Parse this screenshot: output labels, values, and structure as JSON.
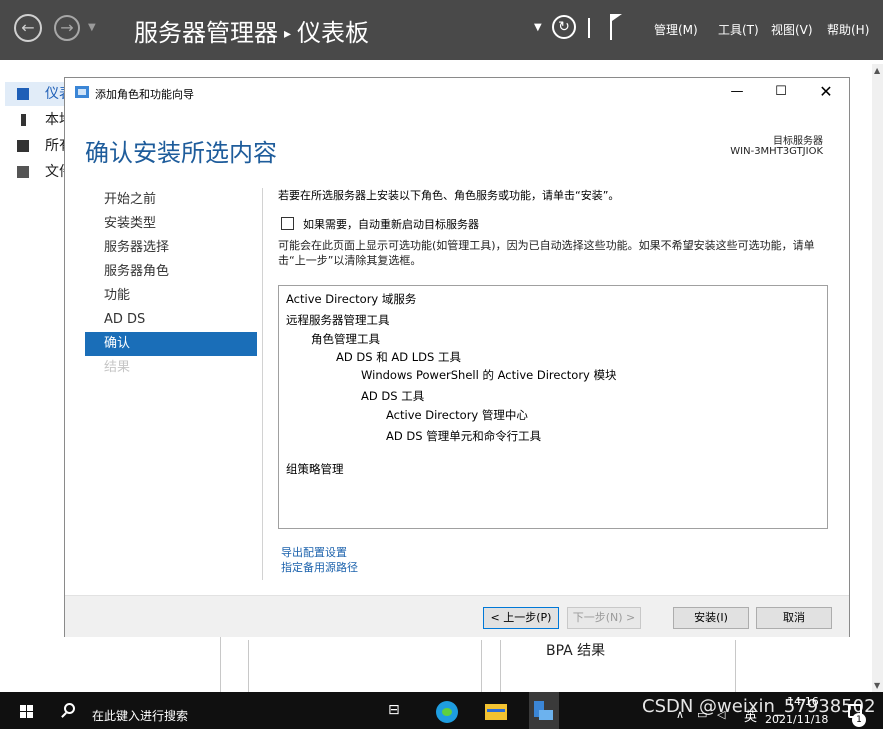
{
  "server_manager": {
    "title": "服务器管理器",
    "breadcrumb_sep": "▸",
    "page": "仪表板",
    "menus": [
      "管理(M)",
      "工具(T)",
      "视图(V)",
      "帮助(H)"
    ],
    "sidebar": [
      "仪表板",
      "本地服务器",
      "所有服务器",
      "文件和存储服务"
    ],
    "bpa_label": "BPA 结果"
  },
  "wizard": {
    "window_title": "添加角色和功能向导",
    "heading": "确认安装所选内容",
    "target_label": "目标服务器",
    "target_name": "WIN-3MHT3GTJIOK",
    "steps": [
      "开始之前",
      "安装类型",
      "服务器选择",
      "服务器角色",
      "功能",
      "AD DS",
      "确认",
      "结果"
    ],
    "current_step": "确认",
    "instruction": "若要在所选服务器上安装以下角色、角色服务或功能，请单击“安装”。",
    "restart_option": "如果需要，自动重新启动目标服务器",
    "restart_checked": false,
    "note": "可能会在此页面上显示可选功能(如管理工具)，因为已自动选择这些功能。如果不希望安装这些可选功能，请单击“上一步”以清除其复选框。",
    "features": [
      {
        "text": "Active Directory 域服务",
        "level": 0
      },
      {
        "text": "远程服务器管理工具",
        "level": 0
      },
      {
        "text": "角色管理工具",
        "level": 1
      },
      {
        "text": "AD DS 和 AD LDS 工具",
        "level": 2
      },
      {
        "text": "Windows PowerShell 的 Active Directory 模块",
        "level": 3
      },
      {
        "text": "AD DS 工具",
        "level": 3
      },
      {
        "text": "Active Directory 管理中心",
        "level": 4
      },
      {
        "text": "AD DS 管理单元和命令行工具",
        "level": 4
      },
      {
        "text": "组策略管理",
        "level": 0
      }
    ],
    "links": [
      "导出配置设置",
      "指定备用源路径"
    ],
    "buttons": {
      "prev": "< 上一步(P)",
      "next": "下一步(N) >",
      "install": "安装(I)",
      "cancel": "取消"
    }
  },
  "taskbar": {
    "search_placeholder": "在此键入进行搜索",
    "watermark": "CSDN @weixin_57938502",
    "lang": "英",
    "time": "14:16",
    "date": "2021/11/18",
    "notification_count": "1"
  },
  "colors": {
    "header_bg": "#494949",
    "accent": "#1a6eb8",
    "heading": "#1e5c9b",
    "link": "#1d63ad"
  }
}
